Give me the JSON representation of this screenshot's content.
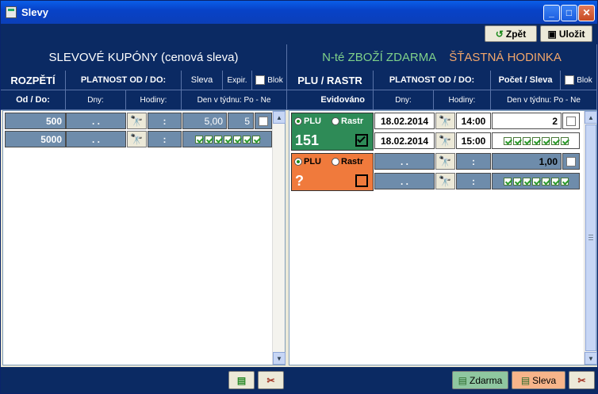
{
  "window": {
    "title": "Slevy"
  },
  "toolbar": {
    "back_label": "Zpět",
    "save_label": "Uložit"
  },
  "left": {
    "title": "SLEVOVÉ  KUPÓNY (cenová sleva)",
    "col_range": "ROZPĚTÍ",
    "col_from_to": "Od / Do:",
    "col_validity": "PLATNOST OD / DO:",
    "col_discount": "Sleva",
    "col_expir": "Expir.",
    "col_block": "Blok",
    "col_days": "Dny:",
    "col_hours": "Hodiny:",
    "col_weekday": "Den v týdnu: Po - Ne",
    "rows": [
      {
        "amount": "500",
        "date": ". .",
        "time": ":",
        "discount": "5,00",
        "expir": "5"
      },
      {
        "amount": "5000",
        "date": ". .",
        "time": ":"
      }
    ]
  },
  "right": {
    "title_a": "N-té  ZBOŽÍ  ZDARMA",
    "title_b": "ŠŤASTNÁ HODINKA",
    "col_plu": "PLU / RASTR",
    "col_registered": "Evidováno",
    "col_validity": "PLATNOST OD / DO:",
    "col_count": "Počet / Sleva",
    "col_block": "Blok",
    "col_days": "Dny:",
    "col_hours": "Hodiny:",
    "col_weekday": "Den v týdnu: Po - Ne",
    "rows": [
      {
        "plu_label": "PLU",
        "rastr_label": "Rastr",
        "code": "151",
        "date_from": "18.02.2014",
        "time_from": "14:00",
        "date_to": "18.02.2014",
        "time_to": "15:00",
        "value": "2"
      },
      {
        "plu_label": "PLU",
        "rastr_label": "Rastr",
        "code": "?",
        "date_from": ". .",
        "time_from": ":",
        "date_to": ". .",
        "time_to": ":",
        "value": "1,00"
      }
    ]
  },
  "footer": {
    "free_label": "Zdarma",
    "discount_label": "Sleva"
  },
  "colors": {
    "navy": "#0b2a63",
    "green": "#2e8b57",
    "orange": "#f07a3c",
    "cell_blue": "#6e8cab"
  }
}
